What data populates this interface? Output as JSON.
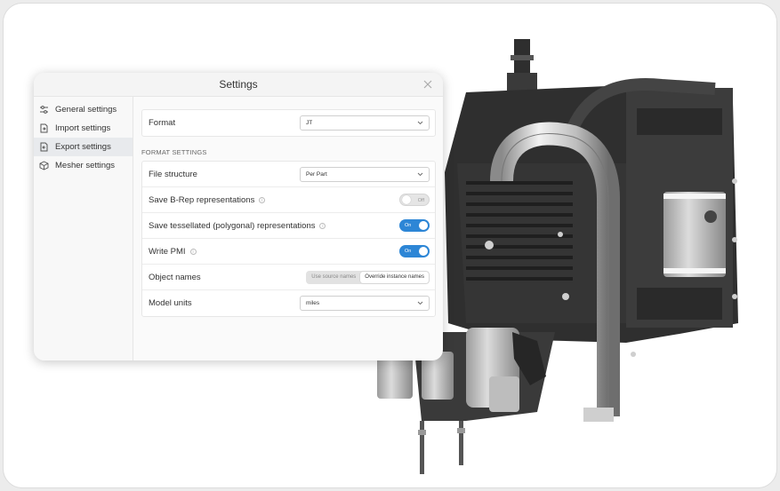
{
  "dialog": {
    "title": "Settings"
  },
  "sidebar": {
    "items": [
      {
        "label": "General settings",
        "icon": "sliders-icon"
      },
      {
        "label": "Import settings",
        "icon": "file-import-icon"
      },
      {
        "label": "Export settings",
        "icon": "file-export-icon",
        "active": true
      },
      {
        "label": "Mesher settings",
        "icon": "cube-icon"
      }
    ]
  },
  "format": {
    "label": "Format",
    "value": "JT"
  },
  "format_settings": {
    "section_label": "FORMAT SETTINGS",
    "file_structure": {
      "label": "File structure",
      "value": "Per Part"
    },
    "save_brep": {
      "label": "Save B-Rep representations",
      "state": "Off"
    },
    "save_tessellated": {
      "label": "Save tessellated (polygonal) representations",
      "state": "On"
    },
    "write_pmi": {
      "label": "Write PMI",
      "state": "On"
    },
    "object_names": {
      "label": "Object names",
      "options": [
        "Use source names",
        "Override instance names"
      ],
      "selected": "Override instance names"
    },
    "model_units": {
      "label": "Model units",
      "value": "miles"
    }
  },
  "colors": {
    "accent": "#2d86d6",
    "active_item_bg": "#e8eaed"
  }
}
